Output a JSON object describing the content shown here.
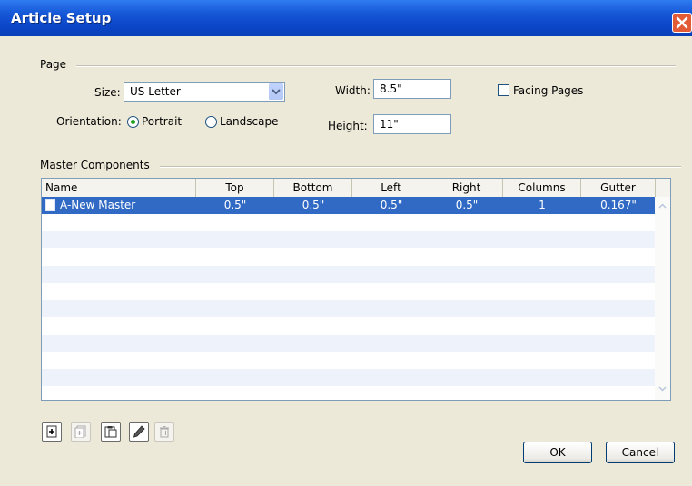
{
  "window": {
    "title": "Article Setup"
  },
  "page_group": {
    "legend": "Page",
    "size_label": "Size:",
    "size_value": "US Letter",
    "orientation_label": "Orientation:",
    "orientation_options": [
      "Portrait",
      "Landscape"
    ],
    "orientation_selected": "Portrait",
    "width_label": "Width:",
    "width_value": "8.5\"",
    "height_label": "Height:",
    "height_value": "11\"",
    "facing_pages_label": "Facing Pages",
    "facing_pages_checked": false
  },
  "master_group": {
    "legend": "Master Components",
    "columns": [
      "Name",
      "Top",
      "Bottom",
      "Left",
      "Right",
      "Columns",
      "Gutter"
    ],
    "rows": [
      {
        "name": "A-New Master",
        "top": "0.5\"",
        "bottom": "0.5\"",
        "left": "0.5\"",
        "right": "0.5\"",
        "columns": "1",
        "gutter": "0.167\""
      }
    ],
    "selected_row": 0
  },
  "toolbar": {
    "icons": [
      "new-master-icon",
      "duplicate-master-icon",
      "paste-master-icon",
      "edit-master-icon",
      "delete-master-icon"
    ]
  },
  "buttons": {
    "ok": "OK",
    "cancel": "Cancel"
  },
  "colors": {
    "title_bar": "#1759d8",
    "selection": "#316ac5",
    "dialog_bg": "#ece9d8",
    "stripe": "#eef3fb"
  }
}
